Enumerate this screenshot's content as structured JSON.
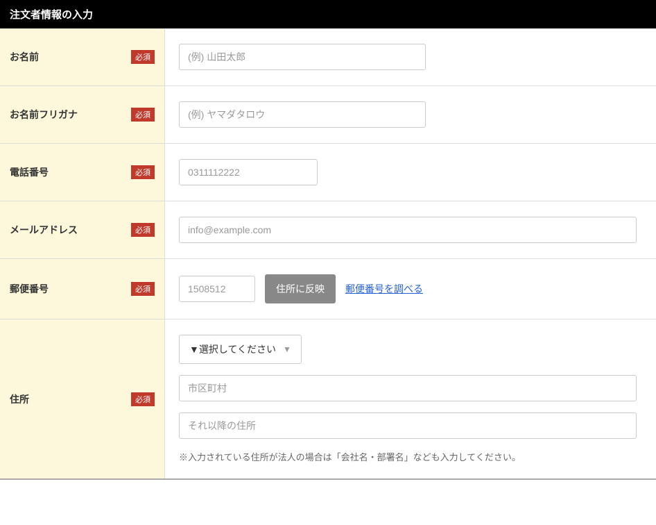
{
  "header": {
    "title": "注文者情報の入力"
  },
  "badges": {
    "required": "必須"
  },
  "fields": {
    "name": {
      "label": "お名前",
      "placeholder": "(例) 山田太郎"
    },
    "nameKana": {
      "label": "お名前フリガナ",
      "placeholder": "(例) ヤマダタロウ"
    },
    "phone": {
      "label": "電話番号",
      "placeholder": "0311112222"
    },
    "email": {
      "label": "メールアドレス",
      "placeholder": "info@example.com"
    },
    "postal": {
      "label": "郵便番号",
      "placeholder": "1508512",
      "applyButton": "住所に反映",
      "lookupLink": "郵便番号を調べる"
    },
    "address": {
      "label": "住所",
      "prefectureSelect": "▼選択してください",
      "cityPlaceholder": "市区町村",
      "restPlaceholder": "それ以降の住所",
      "note": "※入力されている住所が法人の場合は「会社名・部署名」なども入力してください。"
    }
  }
}
